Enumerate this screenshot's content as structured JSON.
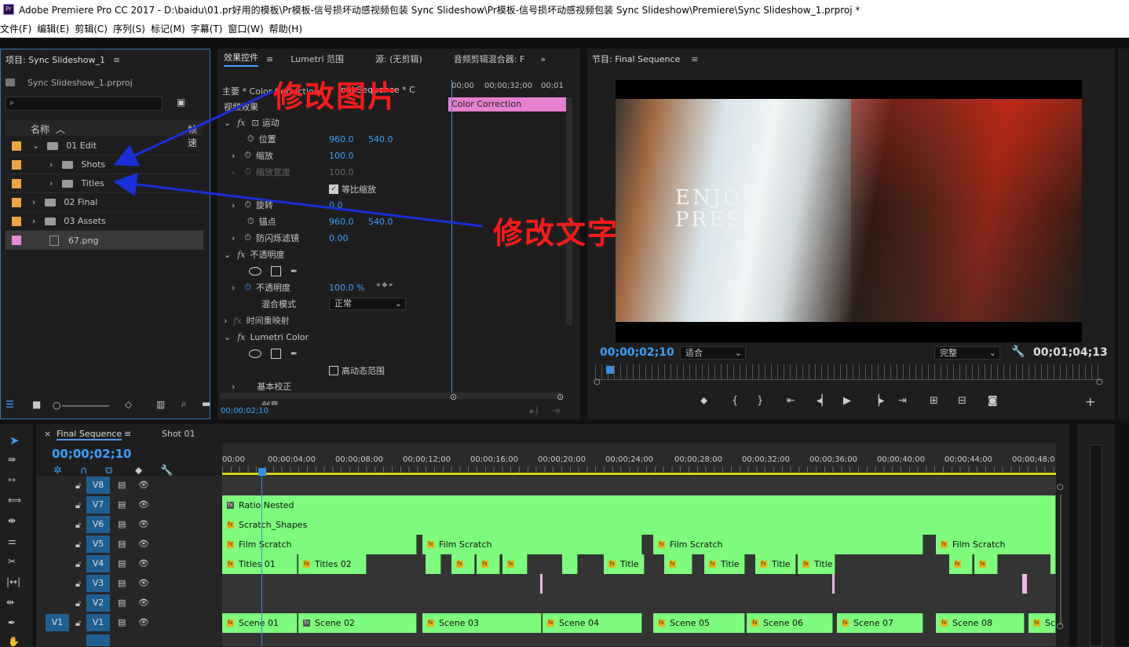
{
  "window": {
    "title": "Adobe Premiere Pro CC 2017 - D:\\baidu\\01.pr好用的模板\\Pr模板-信号损坏动感视频包装 Sync Slideshow\\Pr模板-信号损坏动感视频包装 Sync Slideshow\\Premiere\\Sync Slideshow_1.prproj *",
    "logo": "Pr"
  },
  "menu": [
    "文件(F)",
    "编辑(E)",
    "剪辑(C)",
    "序列(S)",
    "标记(M)",
    "字幕(T)",
    "窗口(W)",
    "帮助(H)"
  ],
  "project": {
    "title": "项目: Sync Slideshow_1",
    "file": "Sync Slideshow_1.prproj",
    "col_name": "名称",
    "col_fps": "帧速",
    "items": [
      {
        "label": "01 Edit",
        "color": "#f0a340"
      },
      {
        "label": "Shots",
        "color": "#f0a340"
      },
      {
        "label": "Titles",
        "color": "#f0a340"
      },
      {
        "label": "02 Final",
        "color": "#f0a340"
      },
      {
        "label": "03 Assets",
        "color": "#f0a340"
      },
      {
        "label": "67.png",
        "color": "#e58bd6"
      }
    ]
  },
  "effects": {
    "tabs": [
      "效果控件",
      "Lumetri 范围",
      "源: (无剪辑)",
      "音频剪辑混合器: F"
    ],
    "master": "主要 * Color Correction",
    "seq_partial": "inal Sequence * C",
    "video_effects": "视频效果",
    "clip_label": "Color Correction",
    "ruler": [
      "00;00",
      "00;00;32;00",
      "00;01"
    ],
    "motion": "运动",
    "position": {
      "label": "位置",
      "x": "960.0",
      "y": "540.0"
    },
    "scale": {
      "label": "缩放",
      "v": "100.0"
    },
    "scale_w": {
      "label": "缩放宽度",
      "v": "100.0"
    },
    "uniform": "等比缩放",
    "rotation": {
      "label": "旋转",
      "v": "0.0"
    },
    "anchor": {
      "label": "锚点",
      "x": "960.0",
      "y": "540.0"
    },
    "flicker": {
      "label": "防闪烁滤镜",
      "v": "0.00"
    },
    "opacity_group": "不透明度",
    "opacity": {
      "label": "不透明度",
      "v": "100.0 %"
    },
    "blend": {
      "label": "混合模式",
      "v": "正常"
    },
    "time_remap": "时间重映射",
    "lumetri": "Lumetri Color",
    "hdr": "高动态范围",
    "basic": "基本校正",
    "creative": "创意",
    "timecode": "00;00;02;10"
  },
  "program": {
    "title": "节目: Final Sequence",
    "video_text_1": "ENJOY",
    "video_text_2": "PRESE",
    "timecode": "00;00;02;10",
    "fit": "适合",
    "quality": "完整",
    "duration": "00;01;04;13"
  },
  "annotations": {
    "image": "修改图片",
    "text": "修改文字"
  },
  "timeline": {
    "tab": "Final Sequence",
    "tab2": "Shot 01",
    "timecode": "00;00;02;10",
    "ruler": [
      "00;00",
      "00;00;04;00",
      "00;00;08;00",
      "00;00;12;00",
      "00;00;16;00",
      "00;00;20;00",
      "00;00;24;00",
      "00;00;28;00",
      "00;00;32;00",
      "00;00;36;00",
      "00;00;40;00",
      "00;00;44;00",
      "00;00;48;0"
    ],
    "tracks": [
      "V8",
      "V7",
      "V6",
      "V5",
      "V4",
      "V3",
      "V2",
      "V1"
    ],
    "source_patch": "V1",
    "clips": {
      "v7": "Ratio Nested",
      "v6": "Scratch_Shapes",
      "v5": [
        "Film Scratch",
        "Film Scratch",
        "Film Scratch",
        "Film Scratch"
      ],
      "v4": [
        "Titles 01",
        "Titles 02",
        "Title",
        "Title",
        "Title",
        "Title"
      ],
      "v1": [
        "Scene 01",
        "Scene 02",
        "Scene 03",
        "Scene 04",
        "Scene 05",
        "Scene 06",
        "Scene 07",
        "Scene 08",
        "Sc"
      ]
    }
  }
}
